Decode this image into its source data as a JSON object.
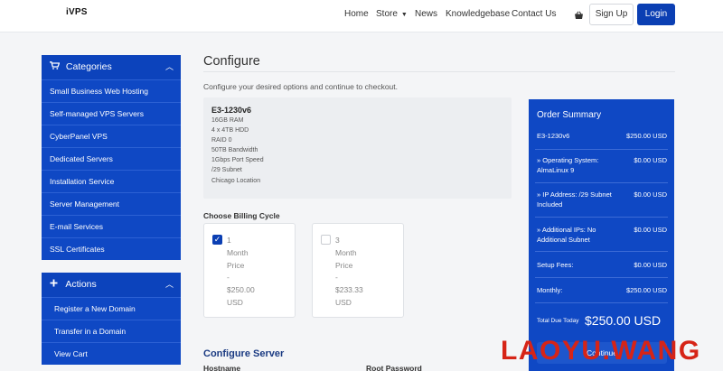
{
  "header": {
    "logo": "iVPS",
    "nav": {
      "home": "Home",
      "store": "Store",
      "news": "News",
      "knowledgebase": "Knowledgebase",
      "contact": "Contact Us"
    },
    "signup": "Sign Up",
    "login": "Login",
    "cart_icon": "basket-icon",
    "accent": "#0b3fb3"
  },
  "sidebar": {
    "categories_title": "Categories",
    "categories": [
      "Small Business Web Hosting",
      "Self-managed VPS Servers",
      "CyberPanel VPS",
      "Dedicated Servers",
      "Installation Service",
      "Server Management",
      "E-mail Services",
      "SSL Certificates"
    ],
    "actions_title": "Actions",
    "actions": [
      "Register a New Domain",
      "Transfer in a Domain",
      "View Cart"
    ],
    "panel_color": "#0f48c4"
  },
  "main": {
    "title": "Configure",
    "subtitle": "Configure your desired options and continue to checkout.",
    "product": {
      "name": "E3-1230v6",
      "specs": [
        "16GB RAM",
        "4 x 4TB HDD",
        "RAID 0",
        "50TB Bandwidth",
        "1Gbps Port Speed",
        "/29 Subnet",
        "Chicago Location"
      ]
    },
    "billing": {
      "title": "Choose Billing Cycle",
      "options": [
        {
          "months": "1",
          "unit": "Month",
          "price_label": "Price",
          "dash": "-",
          "amount": "$250.00",
          "currency": "USD",
          "selected": true
        },
        {
          "months": "3",
          "unit": "Month",
          "price_label": "Price",
          "dash": "-",
          "amount": "$233.33",
          "currency": "USD",
          "selected": false
        }
      ]
    },
    "configure_server": {
      "title": "Configure Server",
      "hostname_label": "Hostname",
      "root_password_label": "Root Password"
    }
  },
  "summary": {
    "title": "Order Summary",
    "rows": [
      {
        "label": "E3-1230v6",
        "value": "$250.00 USD"
      },
      {
        "label": "» Operating System: AlmaLinux 9",
        "value": "$0.00 USD"
      },
      {
        "label": "» IP Address: /29 Subnet Included",
        "value": "$0.00 USD"
      },
      {
        "label": "» Additional IPs: No Additional Subnet",
        "value": "$0.00 USD"
      },
      {
        "label": "Setup Fees:",
        "value": "$0.00 USD"
      },
      {
        "label": "Monthly:",
        "value": "$250.00 USD"
      }
    ],
    "total_label": "Total Due Today",
    "total_value": "$250.00 USD",
    "continue_label": "Continue"
  },
  "watermark": "LAOYU.WANG"
}
